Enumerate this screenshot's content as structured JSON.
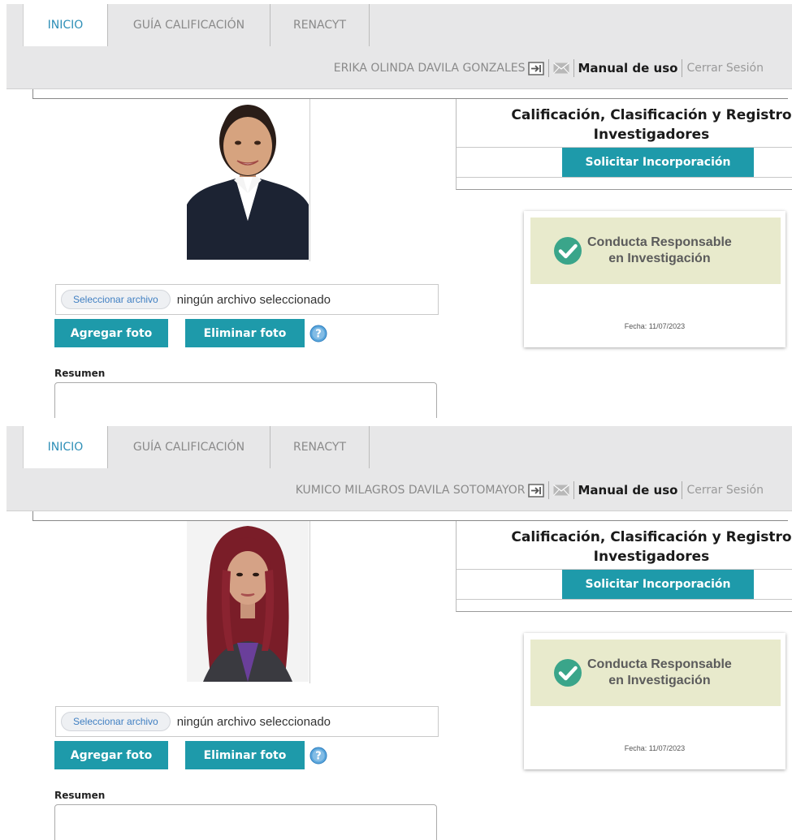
{
  "panels": [
    {
      "tabs": [
        {
          "label": "INICIO"
        },
        {
          "label": "GUÍA CALIFICACIÓN"
        },
        {
          "label": "RENACYT"
        }
      ],
      "user_name": "ERIKA OLINDA DAVILA GONZALES",
      "manual_label": "Manual de uso",
      "logout_label": "Cerrar Sesión",
      "right_title_line1": "Calificación, Clasificación y Registro",
      "right_title_line2": "Investigadores",
      "solicitar_label": "Solicitar Incorporación",
      "badge_line1": "Conducta Responsable",
      "badge_line2": "en Investigación",
      "fecha": "Fecha: 11/07/2023",
      "file_button": "Seleccionar archivo",
      "file_status": "ningún archivo seleccionado",
      "add_photo": "Agregar foto",
      "delete_photo": "Eliminar foto",
      "resumen_label": "Resumen"
    },
    {
      "tabs": [
        {
          "label": "INICIO"
        },
        {
          "label": "GUÍA CALIFICACIÓN"
        },
        {
          "label": "RENACYT"
        }
      ],
      "user_name": "KUMICO MILAGROS DAVILA SOTOMAYOR",
      "manual_label": "Manual de uso",
      "logout_label": "Cerrar Sesión",
      "right_title_line1": "Calificación, Clasificación y Registro",
      "right_title_line2": "Investigadores",
      "solicitar_label": "Solicitar Incorporación",
      "badge_line1": "Conducta Responsable",
      "badge_line2": "en Investigación",
      "fecha": "Fecha: 11/07/2023",
      "file_button": "Seleccionar archivo",
      "file_status": "ningún archivo seleccionado",
      "add_photo": "Agregar foto",
      "delete_photo": "Eliminar foto",
      "resumen_label": "Resumen"
    }
  ],
  "colors": {
    "accent_teal": "#1e9aaa",
    "active_tab_text": "#2e8fb7",
    "badge_green": "#3aa58a",
    "badge_background": "#e8eacc"
  }
}
